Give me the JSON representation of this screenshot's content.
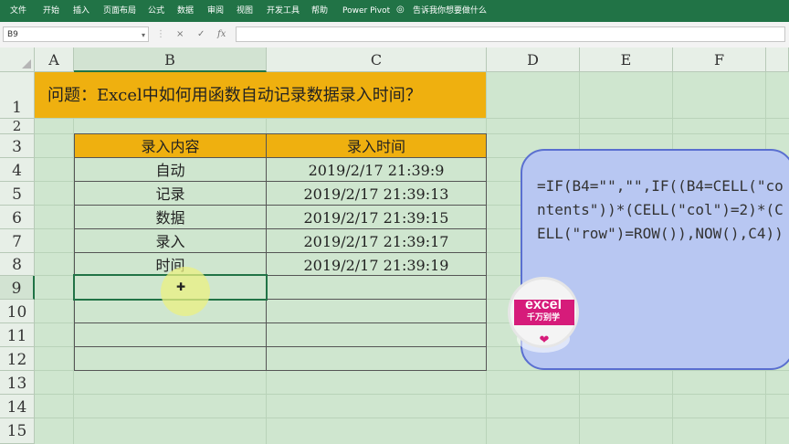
{
  "ribbon": {
    "tabs": [
      "文件",
      "开始",
      "插入",
      "页面布局",
      "公式",
      "数据",
      "审阅",
      "视图",
      "开发工具",
      "帮助",
      "Power Pivot"
    ],
    "tell_me": "告诉我你想要做什么",
    "tell_me_icon": "lightbulb-icon"
  },
  "formula_bar": {
    "name_box": "B9",
    "cancel_icon": "×",
    "enter_icon": "✓",
    "fx_label": "fx",
    "formula": ""
  },
  "columns": [
    "A",
    "B",
    "C",
    "D",
    "E",
    "F"
  ],
  "selected_column": "B",
  "rows": [
    "1",
    "2",
    "3",
    "4",
    "5",
    "6",
    "7",
    "8",
    "9",
    "10",
    "11",
    "12",
    "13",
    "14",
    "15"
  ],
  "selected_row": "9",
  "title": "问题：Excel中如何用函数自动记录数据录入时间？",
  "table": {
    "headers": [
      "录入内容",
      "录入时间"
    ],
    "rows": [
      [
        "自动",
        "2019/2/17  21:39:9"
      ],
      [
        "记录",
        "2019/2/17  21:39:13"
      ],
      [
        "数据",
        "2019/2/17  21:39:15"
      ],
      [
        "录入",
        "2019/2/17  21:39:17"
      ],
      [
        "时间",
        "2019/2/17  21:39:19"
      ],
      [
        "",
        ""
      ],
      [
        "",
        ""
      ],
      [
        "",
        ""
      ],
      [
        "",
        ""
      ]
    ]
  },
  "callout": {
    "formula": "=IF(B4=\"\",\"\",IF((B4=CELL(\"contents\"))*(CELL(\"col\")=2)*(CELL(\"row\")=ROW()),NOW(),C4))"
  },
  "badge": {
    "line1": "excel",
    "line2": "千万别学",
    "icon": "heart-icon"
  },
  "colors": {
    "ribbon": "#217346",
    "banner": "#efb00f",
    "sheet": "#cfe6cf",
    "callout": "#b8c7f2",
    "badge": "#d61b7a"
  }
}
